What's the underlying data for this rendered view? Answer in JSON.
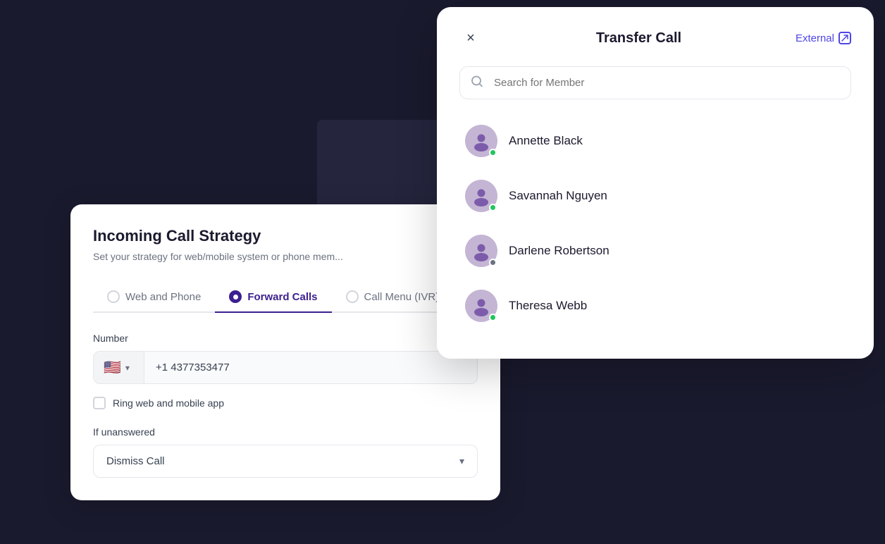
{
  "background": {
    "color": "#1a1a2e"
  },
  "incoming_call_card": {
    "title": "Incoming Call Strategy",
    "subtitle": "Set your strategy for web/mobile system or phone mem...",
    "tabs": [
      {
        "id": "web-phone",
        "label": "Web and Phone",
        "active": false
      },
      {
        "id": "forward-calls",
        "label": "Forward Calls",
        "active": true
      },
      {
        "id": "call-menu",
        "label": "Call Menu (IVR)",
        "active": false
      }
    ],
    "number_label": "Number",
    "phone_value": "+1 4377353477",
    "checkbox_label": "Ring web and mobile app",
    "if_unanswered_label": "If unanswered",
    "dismiss_call_label": "Dismiss Call"
  },
  "transfer_modal": {
    "title": "Transfer Call",
    "external_label": "External",
    "close_icon": "×",
    "search_placeholder": "Search for Member",
    "members": [
      {
        "name": "Annette Black",
        "online": true
      },
      {
        "name": "Savannah Nguyen",
        "online": true
      },
      {
        "name": "Darlene Robertson",
        "online": false
      },
      {
        "name": "Theresa Webb",
        "online": true
      }
    ]
  }
}
